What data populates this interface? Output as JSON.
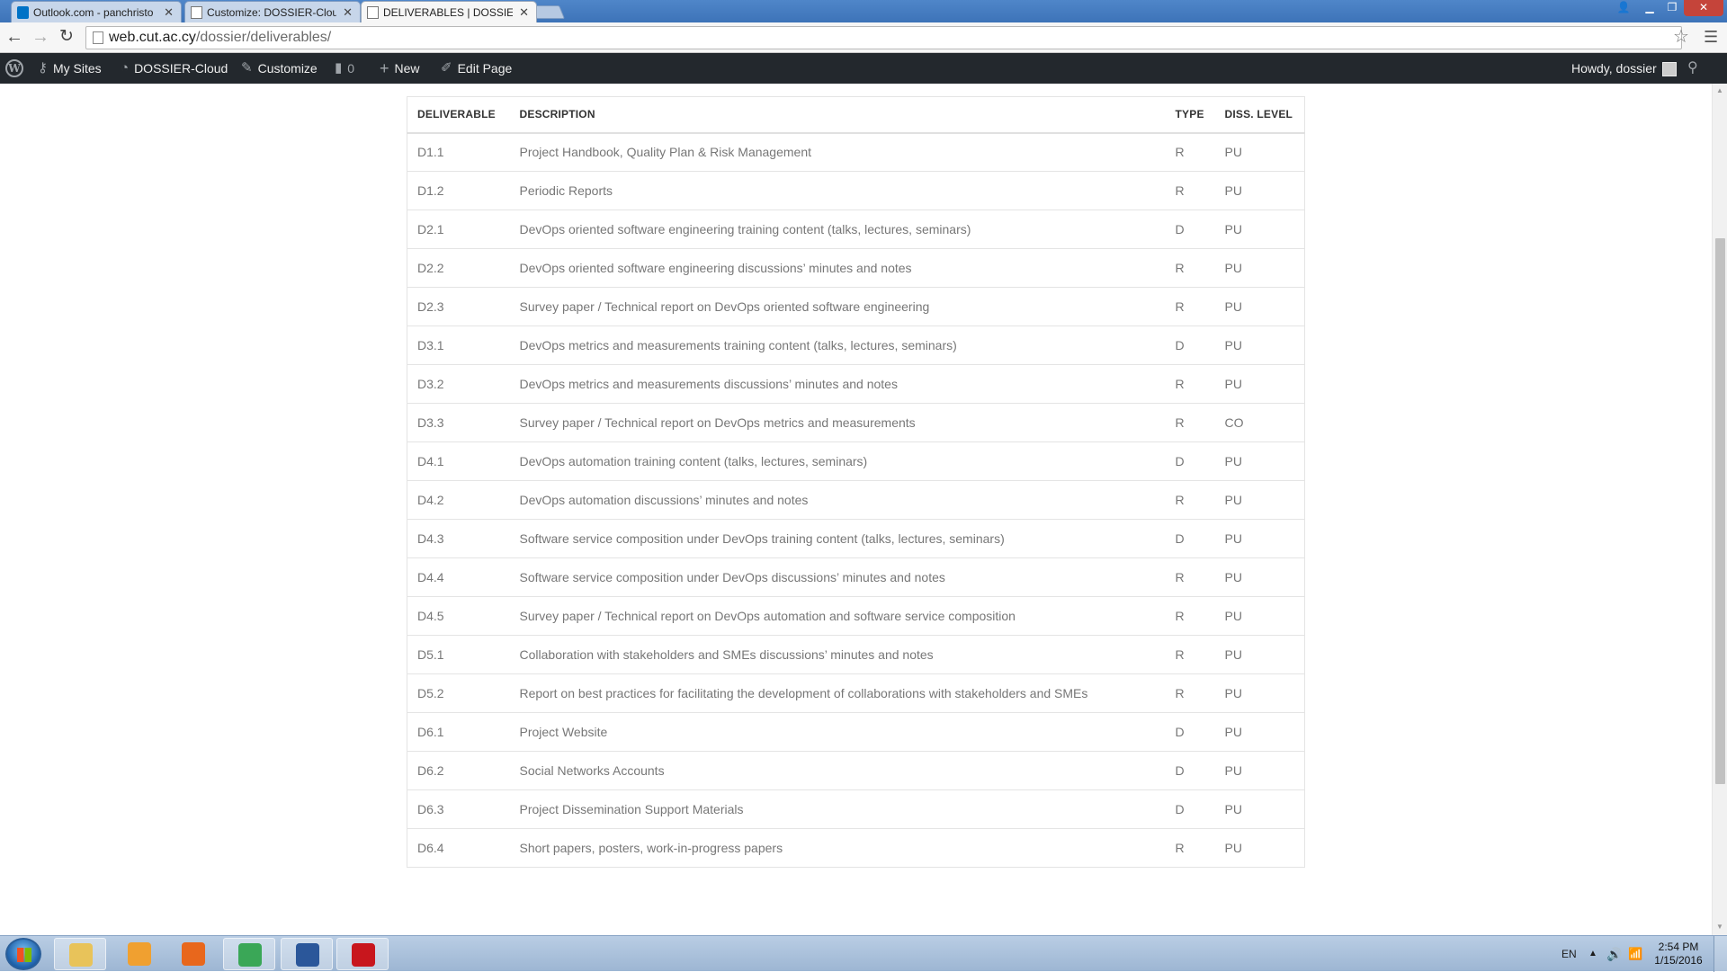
{
  "browser": {
    "tabs": [
      {
        "label": "Outlook.com - panchristo",
        "active": false
      },
      {
        "label": "Customize: DOSSIER-Clou",
        "active": false
      },
      {
        "label": "DELIVERABLES | DOSSIER-",
        "active": true
      }
    ],
    "url_host": "web.cut.ac.cy",
    "url_path": "/dossier/deliverables/"
  },
  "adminbar": {
    "my_sites": "My Sites",
    "site_name": "DOSSIER-Cloud",
    "customize": "Customize",
    "comments_count": "0",
    "new_label": "New",
    "edit_page": "Edit Page",
    "howdy": "Howdy, dossier"
  },
  "table": {
    "headers": [
      "DELIVERABLE",
      "DESCRIPTION",
      "TYPE",
      "DISS. LEVEL"
    ],
    "rows": [
      [
        "D1.1",
        "Project Handbook, Quality Plan & Risk Management",
        "R",
        "PU"
      ],
      [
        "D1.2",
        "Periodic Reports",
        "R",
        "PU"
      ],
      [
        "D2.1",
        "DevOps oriented software engineering training content (talks, lectures, seminars)",
        "D",
        "PU"
      ],
      [
        "D2.2",
        "DevOps oriented software engineering discussions’ minutes and notes",
        "R",
        "PU"
      ],
      [
        "D2.3",
        "Survey paper / Technical report on DevOps oriented software engineering",
        "R",
        "PU"
      ],
      [
        "D3.1",
        "DevOps metrics and measurements training content (talks, lectures, seminars)",
        "D",
        "PU"
      ],
      [
        "D3.2",
        "DevOps metrics and measurements discussions’ minutes and notes",
        "R",
        "PU"
      ],
      [
        "D3.3",
        "Survey paper / Technical report on DevOps metrics and measurements",
        "R",
        "CO"
      ],
      [
        "D4.1",
        "DevOps automation training content (talks, lectures, seminars)",
        "D",
        "PU"
      ],
      [
        "D4.2",
        "DevOps automation discussions’ minutes and notes",
        "R",
        "PU"
      ],
      [
        "D4.3",
        "Software service composition under DevOps training content (talks, lectures, seminars)",
        "D",
        "PU"
      ],
      [
        "D4.4",
        "Software service composition under DevOps discussions’ minutes and notes",
        "R",
        "PU"
      ],
      [
        "D4.5",
        "Survey paper / Technical report on DevOps automation and software service composition",
        "R",
        "PU"
      ],
      [
        "D5.1",
        "Collaboration with stakeholders and SMEs discussions’ minutes and notes",
        "R",
        "PU"
      ],
      [
        "D5.2",
        "Report on best practices for facilitating the development of collaborations with stakeholders and SMEs",
        "R",
        "PU"
      ],
      [
        "D6.1",
        "Project Website",
        "D",
        "PU"
      ],
      [
        "D6.2",
        "Social Networks Accounts",
        "D",
        "PU"
      ],
      [
        "D6.3",
        "Project Dissemination Support Materials",
        "D",
        "PU"
      ],
      [
        "D6.4",
        "Short papers, posters, work-in-progress papers",
        "R",
        "PU"
      ]
    ]
  },
  "taskbar": {
    "apps": [
      {
        "icon": "file-explorer-icon",
        "color": "#e8c35a",
        "open": true
      },
      {
        "icon": "media-player-icon",
        "color": "#f0a030",
        "open": false
      },
      {
        "icon": "firefox-icon",
        "color": "#e8671c",
        "open": false
      },
      {
        "icon": "chrome-icon",
        "color": "#3aa757",
        "open": true
      },
      {
        "icon": "word-icon",
        "color": "#2b579a",
        "open": true
      },
      {
        "icon": "acrobat-icon",
        "color": "#c8161d",
        "open": true
      }
    ],
    "language": "EN",
    "time": "2:54 PM",
    "date": "1/15/2016"
  }
}
